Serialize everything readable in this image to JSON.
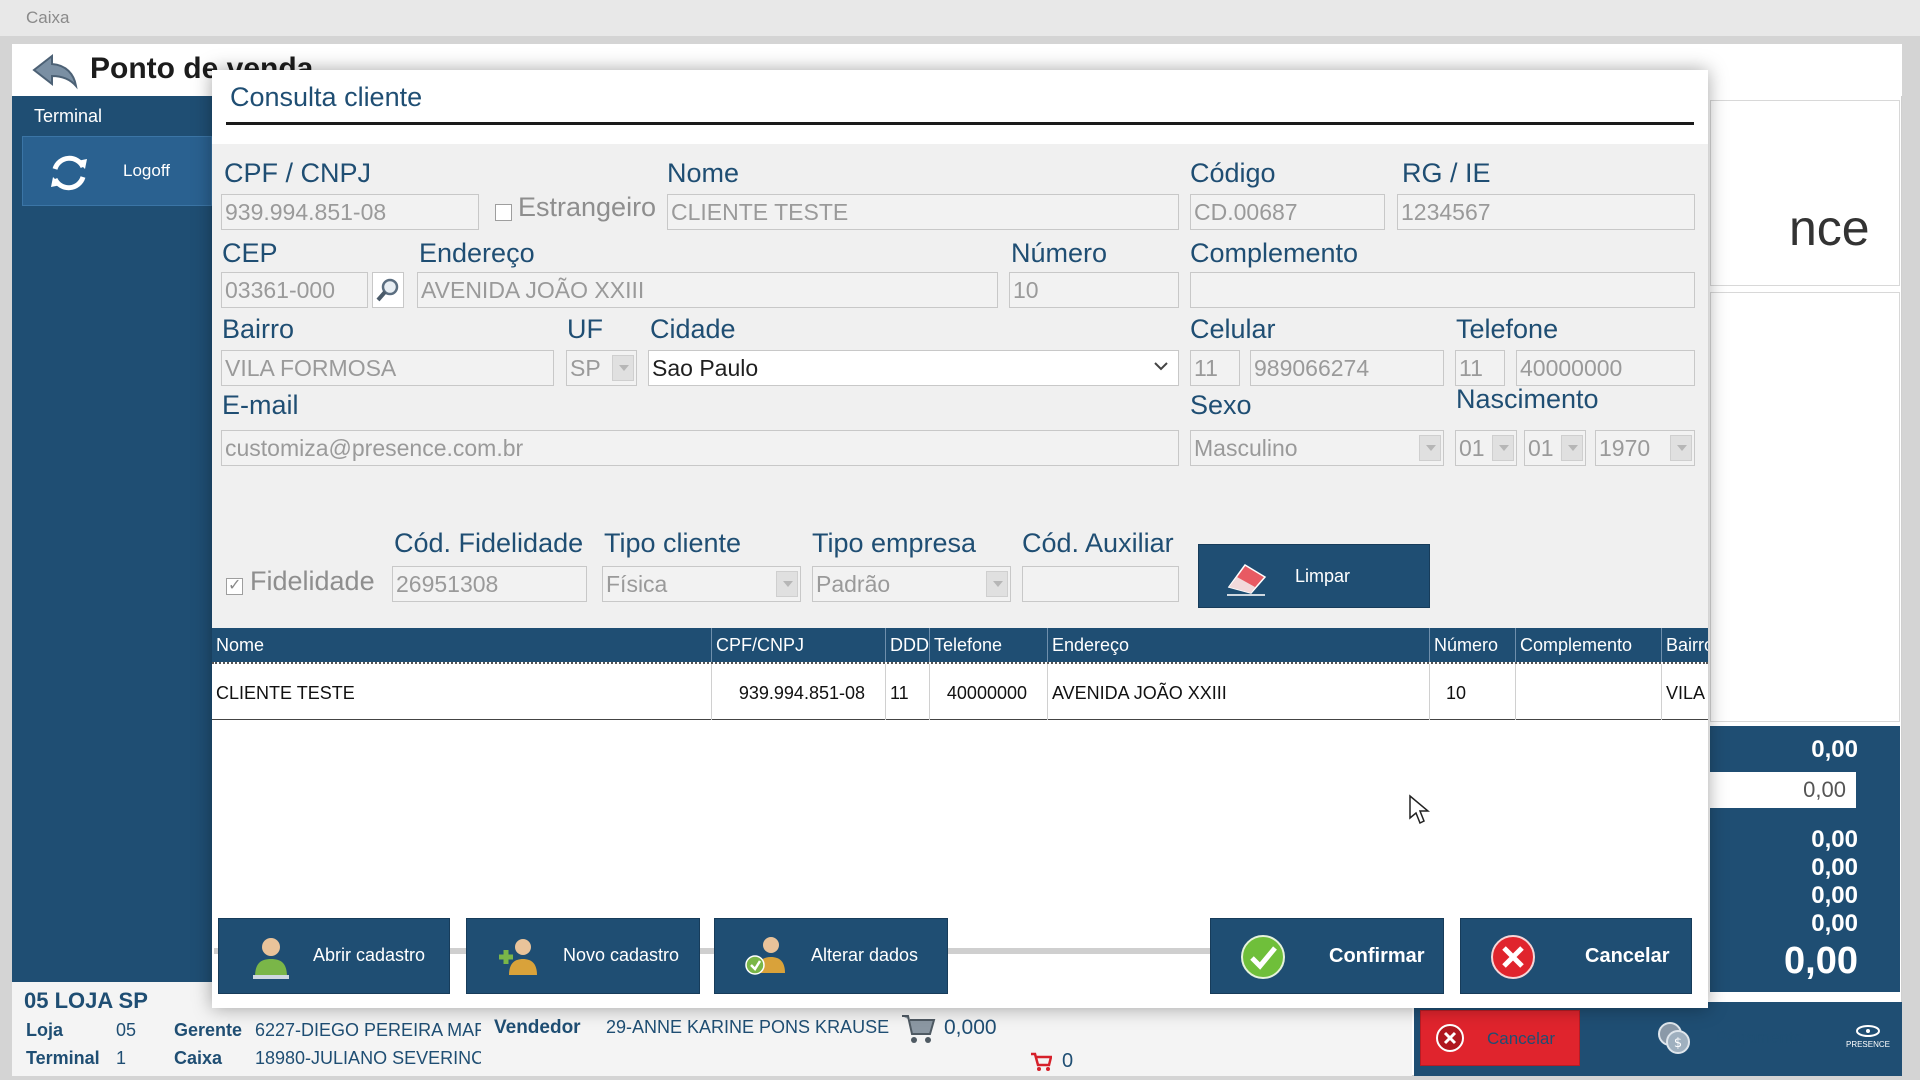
{
  "window": {
    "title": "Caixa"
  },
  "app": {
    "title": "Ponto de venda",
    "terminal_label": "Terminal",
    "logoff_label": "Logoff",
    "brand_fragment": "nce"
  },
  "store": {
    "name": "05 LOJA SP",
    "loja_label": "Loja",
    "loja_value": "05",
    "gerente_label": "Gerente",
    "gerente_value": "6227-DIEGO PEREIRA MAF",
    "terminal_label": "Terminal",
    "terminal_value": "1",
    "caixa_label": "Caixa",
    "caixa_value": "18980-JULIANO SEVERINC"
  },
  "sale": {
    "vendedor_label": "Vendedor",
    "vendedor_value": "29-ANNE KARINE PONS KRAUSE",
    "qty": "0,000",
    "items": "0"
  },
  "totals": {
    "t1": "0,00",
    "input": "0,00",
    "t2": "0,00",
    "t3": "0,00",
    "t4": "0,00",
    "t5": "0,00",
    "total": "0,00"
  },
  "bottom_buttons": {
    "cancelar": "Cancelar",
    "pagamento": "Pagamento",
    "presence_logo": "PRESENCE"
  },
  "modal": {
    "title": "Consulta cliente",
    "labels": {
      "cpf": "CPF / CNPJ",
      "estrangeiro": "Estrangeiro",
      "nome": "Nome",
      "codigo": "Código",
      "rg": "RG / IE",
      "cep": "CEP",
      "endereco": "Endereço",
      "numero": "Número",
      "complemento": "Complemento",
      "bairro": "Bairro",
      "uf": "UF",
      "cidade": "Cidade",
      "celular": "Celular",
      "telefone": "Telefone",
      "email": "E-mail",
      "sexo": "Sexo",
      "nascimento": "Nascimento",
      "fidelidade": "Fidelidade",
      "cod_fidelidade": "Cód. Fidelidade",
      "tipo_cliente": "Tipo cliente",
      "tipo_empresa": "Tipo empresa",
      "cod_auxiliar": "Cód. Auxiliar"
    },
    "values": {
      "cpf": "939.994.851-08",
      "nome": "CLIENTE TESTE",
      "codigo": "CD.00687",
      "rg": "1234567",
      "cep": "03361-000",
      "endereco": "AVENIDA JOÃO XXIII",
      "numero": "10",
      "complemento": "",
      "bairro": "VILA FORMOSA",
      "uf": "SP",
      "cidade": "Sao Paulo",
      "celular_ddd": "11",
      "celular": "989066274",
      "telefone_ddd": "11",
      "telefone": "40000000",
      "email": "customiza@presence.com.br",
      "sexo": "Masculino",
      "nasc_dia": "01",
      "nasc_mes": "01",
      "nasc_ano": "1970",
      "cod_fidelidade": "26951308",
      "tipo_cliente": "Física",
      "tipo_empresa": "Padrão",
      "cod_auxiliar": ""
    },
    "limpar_label": "Limpar",
    "table": {
      "columns": [
        "Nome",
        "CPF/CNPJ",
        "DDD",
        "Telefone",
        "Endereço",
        "Número",
        "Complemento",
        "Bairro"
      ],
      "rows": [
        [
          "CLIENTE TESTE",
          "939.994.851-08",
          "11",
          "40000000",
          "AVENIDA JOÃO XXIII",
          "10",
          "",
          "VILA"
        ]
      ]
    },
    "buttons": {
      "abrir": "Abrir cadastro",
      "novo": "Novo cadastro",
      "alterar": "Alterar dados",
      "confirmar": "Confirmar",
      "cancelar": "Cancelar"
    }
  }
}
